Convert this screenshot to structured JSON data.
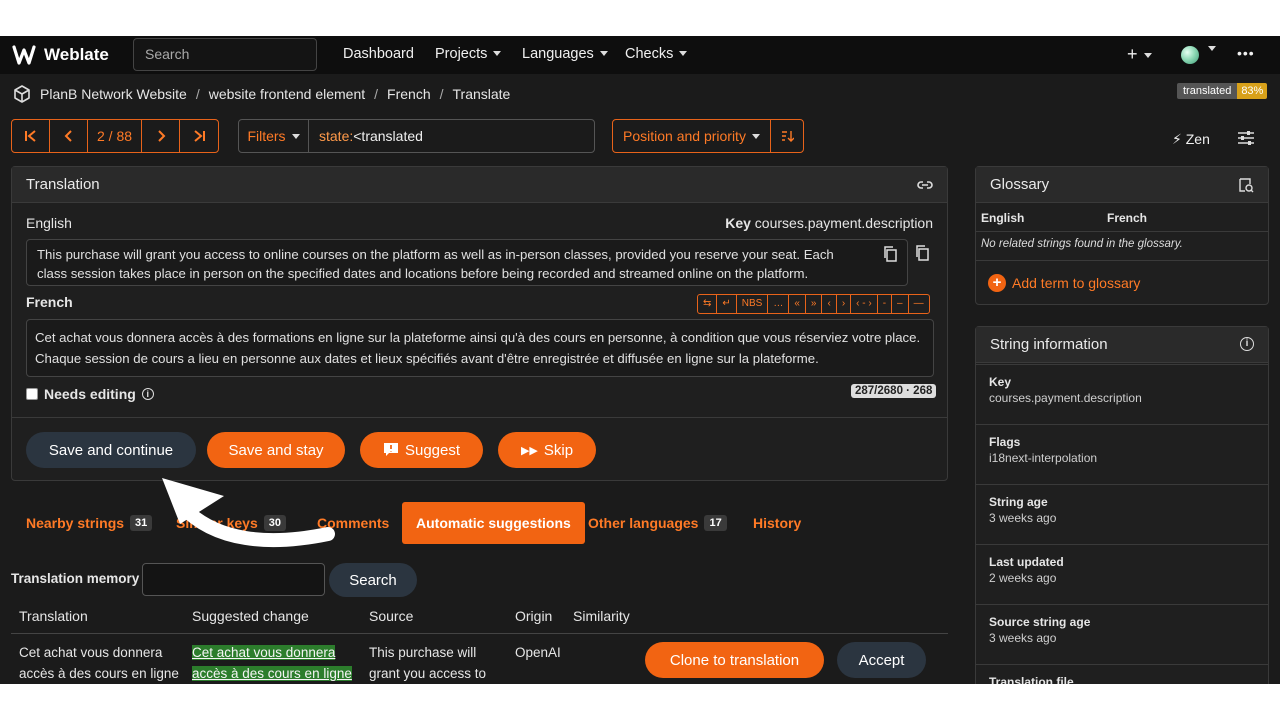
{
  "navbar": {
    "brand": "Weblate",
    "search_placeholder": "Search",
    "links": [
      "Dashboard",
      "Projects",
      "Languages",
      "Checks"
    ],
    "plus": "+",
    "more": "•••"
  },
  "breadcrumb": [
    "PlanB Network Website",
    "website frontend element",
    "French",
    "Translate"
  ],
  "badge": {
    "label": "translated",
    "percent": "83%"
  },
  "pager": {
    "position": "2 / 88"
  },
  "filters": {
    "button": "Filters",
    "query_key": "state:",
    "query_value": "<translated"
  },
  "sort": {
    "label": "Position and priority"
  },
  "zen": {
    "label": "Zen"
  },
  "translation": {
    "title": "Translation",
    "source_lang": "English",
    "key_label": "Key",
    "key_value": "courses.payment.description",
    "source_text": "This purchase will grant you access to online courses on the platform as well as in-person classes, provided you reserve your seat. Each class session takes place in person on the specified dates and locations before being recorded and streamed online on the platform.",
    "target_lang": "French",
    "target_text": "Cet achat vous donnera accès à des formations en ligne sur la plateforme ainsi qu'à des cours en personne, à condition que vous réserviez votre place. Chaque session de cours a lieu en personne aux dates et lieux spécifiés avant d'être enregistrée et diffusée en ligne sur la plateforme.",
    "toolbar": [
      "⇆",
      "↵",
      "NBS",
      "…",
      "«",
      "»",
      "‹",
      "›",
      "‹ - ›",
      "-",
      "–",
      "—"
    ],
    "needs_editing": "Needs editing",
    "counter": "287/2680 · 268"
  },
  "actions": {
    "save_continue": "Save and continue",
    "save_stay": "Save and stay",
    "suggest": "Suggest",
    "skip": "Skip"
  },
  "tabs": [
    {
      "label": "Nearby strings",
      "count": "31"
    },
    {
      "label": "Similar keys",
      "count": "30"
    },
    {
      "label": "Comments",
      "count": ""
    },
    {
      "label": "Automatic suggestions",
      "count": ""
    },
    {
      "label": "Other languages",
      "count": "17"
    },
    {
      "label": "History",
      "count": ""
    }
  ],
  "tm": {
    "label": "Translation memory",
    "search_button": "Search",
    "columns": [
      "Translation",
      "Suggested change",
      "Source",
      "Origin",
      "Similarity"
    ],
    "row": {
      "translation": "Cet achat vous donnera accès à des cours en ligne",
      "suggested": "Cet achat vous donnera accès à des cours en ligne",
      "source": "This purchase will grant you access to",
      "origin": "OpenAI",
      "clone_button": "Clone to translation",
      "accept_button": "Accept"
    }
  },
  "glossary": {
    "title": "Glossary",
    "col_en": "English",
    "col_fr": "French",
    "empty": "No related strings found in the glossary.",
    "add": "Add term to glossary"
  },
  "string_info": {
    "title": "String information",
    "items": [
      {
        "k": "Key",
        "v": "courses.payment.description"
      },
      {
        "k": "Flags",
        "v": "i18next-interpolation"
      },
      {
        "k": "String age",
        "v": "3 weeks ago"
      },
      {
        "k": "Last updated",
        "v": "2 weeks ago"
      },
      {
        "k": "Source string age",
        "v": "3 weeks ago"
      },
      {
        "k": "Translation file",
        "v": ""
      }
    ]
  },
  "colors": {
    "accent": "#f26412",
    "dark_button": "#2b3540",
    "background": "#1b1b1b"
  }
}
